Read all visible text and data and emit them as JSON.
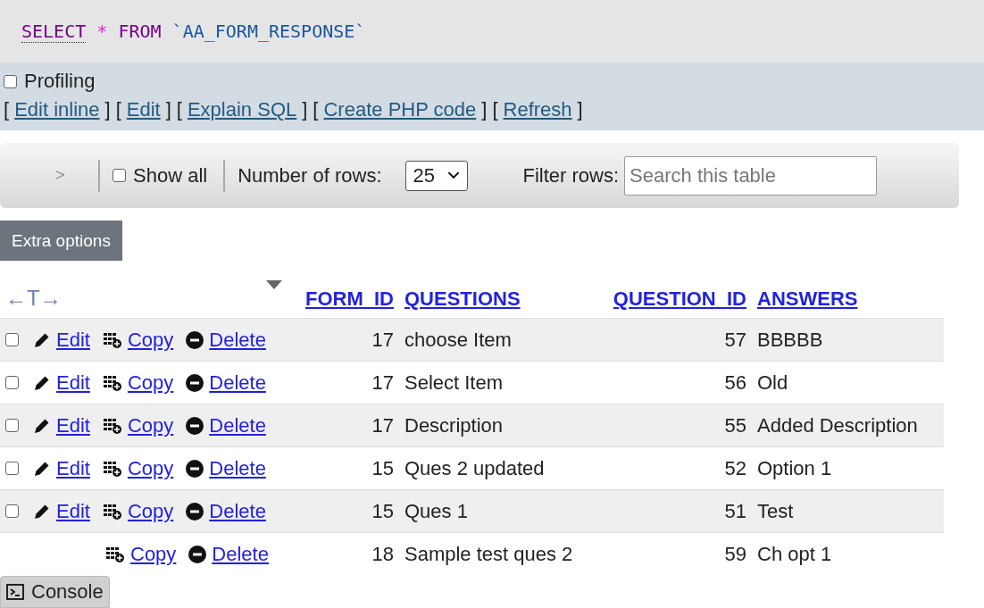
{
  "sql": {
    "keyword1": "SELECT",
    "star": "*",
    "keyword2": "FROM",
    "table": "`AA_FORM_RESPONSE`"
  },
  "profiling": {
    "label": "Profiling",
    "checked": false
  },
  "links": [
    {
      "open": "[",
      "label": "Edit inline",
      "close": "]"
    },
    {
      "open": "[",
      "label": "Edit",
      "close": "]"
    },
    {
      "open": "[",
      "label": "Explain SQL",
      "close": "]"
    },
    {
      "open": "[",
      "label": "Create PHP code",
      "close": "]"
    },
    {
      "open": "[",
      "label": "Refresh",
      "close": "]"
    }
  ],
  "nav": {
    "next": ">",
    "show_all": {
      "label": "Show all",
      "checked": false
    },
    "rows_label": "Number of rows:",
    "rows_value": "25",
    "filter_label": "Filter rows:",
    "filter_placeholder": "Search this table"
  },
  "extra_options": "Extra options",
  "table": {
    "toggle": "←T→",
    "columns": [
      {
        "label": "FORM_ID"
      },
      {
        "label": "QUESTIONS"
      },
      {
        "label": "QUESTION_ID"
      },
      {
        "label": "ANSWERS"
      }
    ],
    "rows": [
      {
        "covered": false,
        "checked": false,
        "edit": "Edit",
        "copy": "Copy",
        "delete": "Delete",
        "cells": [
          "17",
          "choose Item",
          "57",
          "BBBBB"
        ]
      },
      {
        "covered": false,
        "checked": false,
        "edit": "Edit",
        "copy": "Copy",
        "delete": "Delete",
        "cells": [
          "17",
          "Select Item",
          "56",
          "Old"
        ]
      },
      {
        "covered": false,
        "checked": false,
        "edit": "Edit",
        "copy": "Copy",
        "delete": "Delete",
        "cells": [
          "17",
          "Description",
          "55",
          "Added Description"
        ]
      },
      {
        "covered": false,
        "checked": false,
        "edit": "Edit",
        "copy": "Copy",
        "delete": "Delete",
        "cells": [
          "15",
          "Ques 2 updated",
          "52",
          "Option 1"
        ]
      },
      {
        "covered": false,
        "checked": false,
        "edit": "Edit",
        "copy": "Copy",
        "delete": "Delete",
        "cells": [
          "15",
          "Ques 1",
          "51",
          "Test"
        ]
      },
      {
        "covered": true,
        "copy": "Copy",
        "delete": "Delete",
        "cells": [
          "18",
          "Sample test ques 2",
          "59",
          "Ch opt 1"
        ]
      }
    ]
  },
  "console": {
    "label": "Console"
  }
}
